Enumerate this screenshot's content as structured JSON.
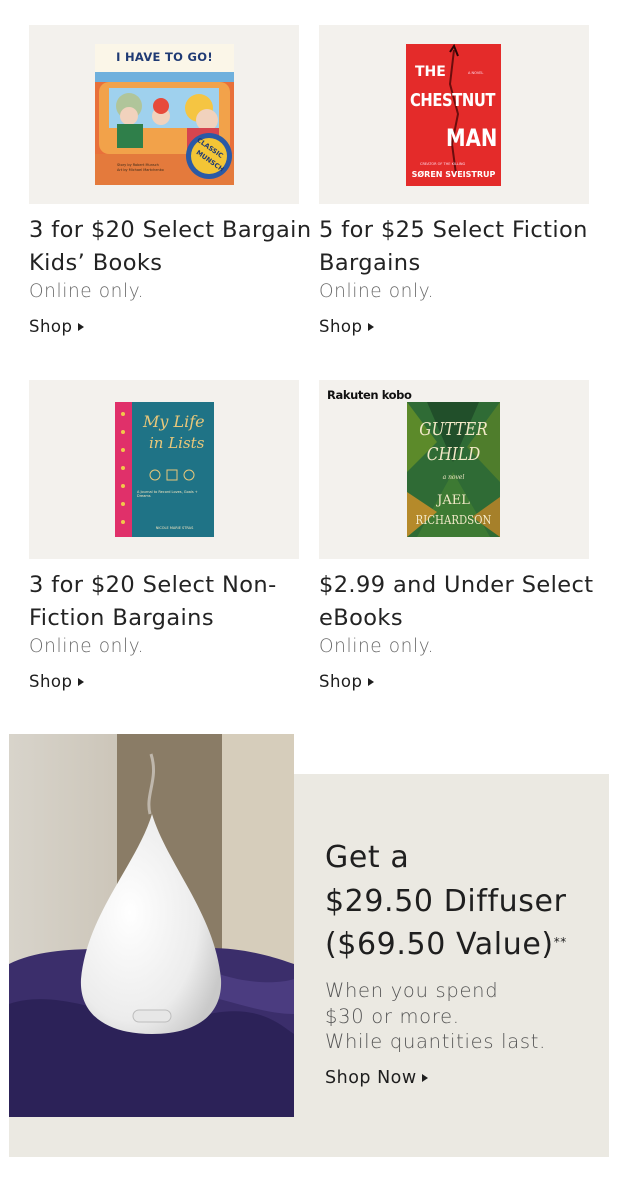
{
  "tiles": [
    {
      "title": "3 for $20 Select Bargain Kids’ Books",
      "note": "Online only.",
      "shop": "Shop",
      "cover": {
        "heading": "I HAVE TO GO!",
        "badge_top": "CLASSIC",
        "badge_bottom": "MUNSCH",
        "credit_1": "Story by Robert Munsch",
        "credit_2": "Art by Michael Martchenko"
      }
    },
    {
      "title": "5 for $25 Select Fiction Bargains",
      "note": "Online only.",
      "shop": "Shop",
      "cover": {
        "tag": "A NOVEL",
        "line_1": "THE",
        "line_2": "CHESTNUT",
        "line_3": "MAN",
        "small": "CREATOR OF THE KILLING",
        "author": "SØREN SVEISTRUP"
      }
    },
    {
      "title": "3 for $20 Select Non-Fiction Bargains",
      "note": "Online only.",
      "shop": "Shop",
      "cover": {
        "line_1": "My Life",
        "line_2": "in Lists",
        "tagline": "A Journal to Record Loves, Goals + Dreams",
        "publisher": "NICOLE MARIE STRAS"
      }
    },
    {
      "title": "$2.99 and Under Select eBooks",
      "note": "Online only.",
      "shop": "Shop",
      "brand": "Rakuten kobo",
      "cover": {
        "line_1": "GUTTER",
        "line_2": "CHILD",
        "tag": "a novel",
        "author_1": "JAEL",
        "author_2": "RICHARDSON"
      }
    }
  ],
  "promo": {
    "title_1": "Get a",
    "title_2": "$29.50 Diffuser",
    "title_3": "($69.50 Value)",
    "title_mark": "**",
    "sub_1": "When you spend",
    "sub_2": "$30 or more.",
    "sub_3": "While quantities last.",
    "shop": "Shop Now"
  }
}
